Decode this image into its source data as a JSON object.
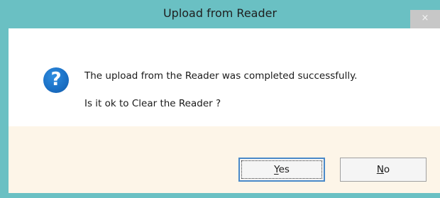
{
  "window": {
    "title": "Upload from Reader",
    "close_glyph": "×"
  },
  "message": {
    "icon": "question-icon",
    "icon_glyph": "?",
    "line1": "The upload from the Reader was completed successfully.",
    "line2": "Is it ok to Clear the Reader ?"
  },
  "buttons": {
    "yes_label": "Yes",
    "no_label": "No"
  },
  "colors": {
    "title_bar": "#6ac0c3",
    "footer": "#fdf5e8",
    "icon": "#1a6fc4"
  }
}
